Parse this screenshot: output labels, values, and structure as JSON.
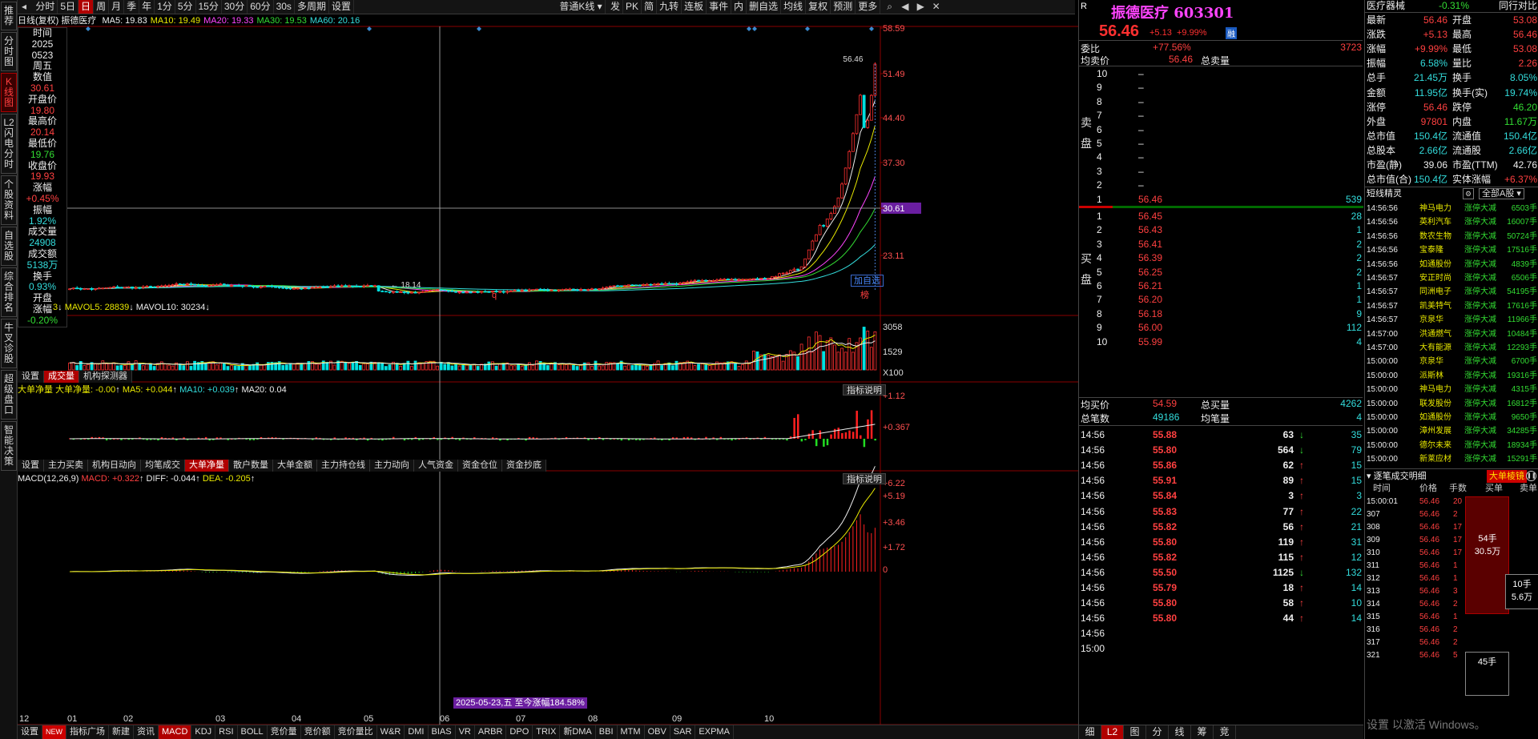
{
  "left_tabs": [
    "推荐",
    "分时图",
    "K线图",
    "L2闪电分时",
    "个股资料",
    "自选股",
    "综合排名",
    "牛叉诊股",
    "超级盘口",
    "智能决策"
  ],
  "toolbar": {
    "items": [
      "分时",
      "5日",
      "日",
      "周",
      "月",
      "季",
      "年",
      "1分",
      "5分",
      "15分",
      "30分",
      "60分",
      "30s",
      "多周期",
      "设置"
    ],
    "kline_type": "普通K线",
    "right_items": [
      "发",
      "PK",
      "简",
      "九转",
      "连板",
      "事件",
      "内",
      "删自选",
      "均线",
      "复权",
      "预测",
      "更多"
    ]
  },
  "kline": {
    "title": "日线(复权)",
    "stock": "振德医疗",
    "ma": [
      {
        "label": "MA5: 19.83",
        "color": "#eeeeee"
      },
      {
        "label": "MA10: 19.49",
        "color": "#e8e800"
      },
      {
        "label": "MA20: 19.33",
        "color": "#ff44ff"
      },
      {
        "label": "MA30: 19.53",
        "color": "#33dd33"
      },
      {
        "label": "MA60: 20.16",
        "color": "#33dddd"
      }
    ],
    "yticks": [
      "58.59",
      "51.49",
      "44.40",
      "37.30",
      "30.61",
      "23.11"
    ],
    "cursor_price": "30.61",
    "high_label": "56.46",
    "low_label": "18.14",
    "add_watch": "加自选",
    "q_marker": "q",
    "bang_marker": "榜"
  },
  "data_panel": [
    {
      "k": "时间",
      "c": "w"
    },
    {
      "k": "2025",
      "c": "w"
    },
    {
      "k": "0523",
      "c": "w"
    },
    {
      "k": "周五",
      "c": "w"
    },
    {
      "k": "数值",
      "c": "w"
    },
    {
      "k": "30.61",
      "c": "r"
    },
    {
      "k": "开盘价",
      "c": "w"
    },
    {
      "k": "19.80",
      "c": "r"
    },
    {
      "k": "最高价",
      "c": "w"
    },
    {
      "k": "20.14",
      "c": "r"
    },
    {
      "k": "最低价",
      "c": "w"
    },
    {
      "k": "19.76",
      "c": "g"
    },
    {
      "k": "收盘价",
      "c": "w"
    },
    {
      "k": "19.93",
      "c": "r"
    },
    {
      "k": "涨幅",
      "c": "w"
    },
    {
      "k": "+0.45%",
      "c": "r"
    },
    {
      "k": "振幅",
      "c": "w"
    },
    {
      "k": "1.92%",
      "c": "c"
    },
    {
      "k": "成交量",
      "c": "w"
    },
    {
      "k": "24908",
      "c": "c"
    },
    {
      "k": "成交额",
      "c": "w"
    },
    {
      "k": "5138万",
      "c": "c"
    },
    {
      "k": "换手",
      "c": "w"
    },
    {
      "k": "0.93%",
      "c": "c"
    },
    {
      "k": "开盘",
      "c": "w"
    },
    {
      "k": "涨幅",
      "c": "w"
    },
    {
      "k": "-0.20%",
      "c": "g"
    }
  ],
  "volume": {
    "info_prefix": "3",
    "mavol5": "MAVOL5: 28839",
    "mavol10": "MAVOL10: 30234",
    "yticks": [
      "3058",
      "1529"
    ],
    "unit": "X100"
  },
  "vol_tabs": [
    "设置",
    "成交量",
    "机构探测器"
  ],
  "bigorder": {
    "title": "大单净量",
    "line": "大单净量: -0.00",
    "ma5": "MA5: +0.044",
    "ma10": "MA10: +0.039",
    "ma20": "MA20: 0.04",
    "indicator_btn": "指标说明",
    "yticks": [
      "+1.12",
      "+0.367"
    ]
  },
  "flow_tabs": [
    "设置",
    "主力买卖",
    "机构日动向",
    "均笔成交",
    "大单净量",
    "散户数量",
    "大单金额",
    "主力持仓线",
    "主力动向",
    "人气资金",
    "资金仓位",
    "资金抄底"
  ],
  "macd": {
    "title": "MACD(12,26,9)",
    "macd": "MACD: +0.322",
    "diff": "DIFF: -0.044",
    "dea": "DEA: -0.205",
    "indicator_btn": "指标说明",
    "yticks": [
      "+6.22",
      "+5.19",
      "+3.46",
      "+1.72",
      "0"
    ],
    "date_marker": "2025-05-23,五 至今涨幅184.58%"
  },
  "xaxis": [
    "12",
    "01",
    "02",
    "03",
    "04",
    "05",
    "06",
    "07",
    "08",
    "09",
    "10"
  ],
  "bottom_bar": [
    "设置",
    "NEW",
    "指标广场",
    "新建",
    "资讯",
    "MACD",
    "KDJ",
    "RSI",
    "BOLL",
    "竞价量",
    "竞价额",
    "竞价量比",
    "W&R",
    "DMI",
    "BIAS",
    "VR",
    "ARBR",
    "DPO",
    "TRIX",
    "新DMA",
    "BBI",
    "MTM",
    "OBV",
    "SAR",
    "EXPMA"
  ],
  "quote": {
    "market": "R",
    "name": "振德医疗",
    "code": "603301",
    "price": "56.46",
    "change": "+5.13",
    "pct": "+9.99%",
    "badge": "融",
    "weibi_label": "委比",
    "weibi": "+77.56%",
    "weicha": "3723",
    "avg_sell_label": "均卖价",
    "avg_sell": "56.46",
    "total_sell_label": "总卖量",
    "total_sell": "",
    "sell_label": "卖盘",
    "buy_label": "买盘",
    "sells": [
      {
        "n": "10",
        "p": "–",
        "v": ""
      },
      {
        "n": "9",
        "p": "–",
        "v": ""
      },
      {
        "n": "8",
        "p": "–",
        "v": ""
      },
      {
        "n": "7",
        "p": "–",
        "v": ""
      },
      {
        "n": "6",
        "p": "–",
        "v": ""
      },
      {
        "n": "5",
        "p": "–",
        "v": ""
      },
      {
        "n": "4",
        "p": "–",
        "v": ""
      },
      {
        "n": "3",
        "p": "–",
        "v": ""
      },
      {
        "n": "2",
        "p": "–",
        "v": ""
      },
      {
        "n": "1",
        "p": "56.46",
        "v": "539"
      }
    ],
    "buys": [
      {
        "n": "1",
        "p": "56.45",
        "v": "28"
      },
      {
        "n": "2",
        "p": "56.43",
        "v": "1"
      },
      {
        "n": "3",
        "p": "56.41",
        "v": "2"
      },
      {
        "n": "4",
        "p": "56.39",
        "v": "2"
      },
      {
        "n": "5",
        "p": "56.25",
        "v": "2"
      },
      {
        "n": "6",
        "p": "56.21",
        "v": "1"
      },
      {
        "n": "7",
        "p": "56.20",
        "v": "1"
      },
      {
        "n": "8",
        "p": "56.18",
        "v": "9"
      },
      {
        "n": "9",
        "p": "56.00",
        "v": "112"
      },
      {
        "n": "10",
        "p": "55.99",
        "v": "4"
      }
    ],
    "avg_buy_label": "均买价",
    "avg_buy": "54.59",
    "total_buy_label": "总买量",
    "total_buy": "4262",
    "total_trades_label": "总笔数",
    "total_trades": "49186",
    "avg_trade_label": "均笔量",
    "avg_trade": "4",
    "ticks": [
      {
        "t": "14:56",
        "p": "55.88",
        "v": "63",
        "d": "down",
        "n": "35"
      },
      {
        "t": "14:56",
        "p": "55.80",
        "v": "564",
        "d": "down",
        "n": "79"
      },
      {
        "t": "14:56",
        "p": "55.86",
        "v": "62",
        "d": "up",
        "n": "15"
      },
      {
        "t": "14:56",
        "p": "55.91",
        "v": "89",
        "d": "up",
        "n": "15"
      },
      {
        "t": "14:56",
        "p": "55.84",
        "v": "3",
        "d": "up",
        "n": "3"
      },
      {
        "t": "14:56",
        "p": "55.83",
        "v": "77",
        "d": "up",
        "n": "22"
      },
      {
        "t": "14:56",
        "p": "55.82",
        "v": "56",
        "d": "up",
        "n": "21"
      },
      {
        "t": "14:56",
        "p": "55.80",
        "v": "119",
        "d": "up",
        "n": "31"
      },
      {
        "t": "14:56",
        "p": "55.82",
        "v": "115",
        "d": "up",
        "n": "12"
      },
      {
        "t": "14:56",
        "p": "55.50",
        "v": "1125",
        "d": "down",
        "n": "132"
      },
      {
        "t": "14:56",
        "p": "55.79",
        "v": "18",
        "d": "up",
        "n": "14"
      },
      {
        "t": "14:56",
        "p": "55.80",
        "v": "58",
        "d": "up",
        "n": "10"
      },
      {
        "t": "14:56",
        "p": "55.80",
        "v": "44",
        "d": "up",
        "n": "14"
      },
      {
        "t": "14:56",
        "p": "",
        "v": "",
        "d": "",
        "n": ""
      },
      {
        "t": "15:00",
        "p": "",
        "v": "",
        "d": "",
        "n": ""
      }
    ],
    "bottom_tabs": [
      "细",
      "L2",
      "图",
      "分",
      "线",
      "筹",
      "竞"
    ]
  },
  "stats": {
    "sector": "医疗器械",
    "sector_pct": "-0.31%",
    "sector_link": "同行对比",
    "rows": [
      [
        "最新",
        "56.46",
        "r",
        "开盘",
        "53.08",
        "r"
      ],
      [
        "涨跌",
        "+5.13",
        "r",
        "最高",
        "56.46",
        "r"
      ],
      [
        "涨幅",
        "+9.99%",
        "r",
        "最低",
        "53.08",
        "r"
      ],
      [
        "振幅",
        "6.58%",
        "c",
        "量比",
        "2.26",
        "r"
      ],
      [
        "总手",
        "21.45万",
        "c",
        "换手",
        "8.05%",
        "c"
      ],
      [
        "金额",
        "11.95亿",
        "c",
        "换手(实)",
        "19.74%",
        "c"
      ],
      [
        "涨停",
        "56.46",
        "r",
        "跌停",
        "46.20",
        "g"
      ],
      [
        "外盘",
        "97801",
        "r",
        "内盘",
        "11.67万",
        "g"
      ],
      [
        "总市值",
        "150.4亿",
        "c",
        "流通值",
        "150.4亿",
        "c"
      ],
      [
        "总股本",
        "2.66亿",
        "c",
        "流通股",
        "2.66亿",
        "c"
      ],
      [
        "市盈(静)",
        "39.06",
        "w",
        "市盈(TTM)",
        "42.76",
        "w"
      ],
      [
        "总市值(合)",
        "150.4亿",
        "c",
        "实体涨幅",
        "+6.37%",
        "r"
      ]
    ],
    "elf_title": "短线精灵",
    "elf_filter": "全部A股",
    "elf": [
      [
        "14:56:56",
        "神马电力",
        "涨停大减",
        "6503手"
      ],
      [
        "14:56:56",
        "英利汽车",
        "涨停大减",
        "16007手"
      ],
      [
        "14:56:56",
        "数农生物",
        "涨停大减",
        "50724手"
      ],
      [
        "14:56:56",
        "宝泰隆",
        "涨停大减",
        "17516手"
      ],
      [
        "14:56:56",
        "如通股份",
        "涨停大减",
        "4839手"
      ],
      [
        "14:56:57",
        "安正时尚",
        "涨停大减",
        "6506手"
      ],
      [
        "14:56:57",
        "同洲电子",
        "涨停大减",
        "54195手"
      ],
      [
        "14:56:57",
        "凯美特气",
        "涨停大减",
        "17616手"
      ],
      [
        "14:56:57",
        "京泉华",
        "涨停大减",
        "11966手"
      ],
      [
        "14:57:00",
        "洪通燃气",
        "涨停大减",
        "10484手"
      ],
      [
        "14:57:00",
        "大有能源",
        "涨停大减",
        "12293手"
      ],
      [
        "15:00:00",
        "京泉华",
        "涨停大减",
        "6700手"
      ],
      [
        "15:00:00",
        "派斯林",
        "涨停大减",
        "19316手"
      ],
      [
        "15:00:00",
        "神马电力",
        "涨停大减",
        "4315手"
      ],
      [
        "15:00:00",
        "联发股份",
        "涨停大减",
        "16812手"
      ],
      [
        "15:00:00",
        "如通股份",
        "涨停大减",
        "9650手"
      ],
      [
        "15:00:00",
        "漳州发展",
        "涨停大减",
        "34285手"
      ],
      [
        "15:00:00",
        "德尔未来",
        "涨停大减",
        "18934手"
      ],
      [
        "15:00:00",
        "新莱应材",
        "涨停大减",
        "15291手"
      ]
    ],
    "ticker_title": "逐笔成交明细",
    "ticker_btn": "大单棱镜",
    "ticker_head": [
      "时间",
      "价格",
      "手数",
      "买单",
      "卖单"
    ],
    "ticker": [
      [
        "15:00:01",
        "56.46",
        "20"
      ],
      [
        "307",
        "56.46",
        "2"
      ],
      [
        "308",
        "56.46",
        "17"
      ],
      [
        "309",
        "56.46",
        "17"
      ],
      [
        "310",
        "56.46",
        "17"
      ],
      [
        "311",
        "56.46",
        "1"
      ],
      [
        "312",
        "56.46",
        "1"
      ],
      [
        "313",
        "56.46",
        "3"
      ],
      [
        "314",
        "56.46",
        "2"
      ],
      [
        "315",
        "56.46",
        "1"
      ],
      [
        "316",
        "56.46",
        "2"
      ],
      [
        "317",
        "56.46",
        "2"
      ],
      [
        "321",
        "56.46",
        "5"
      ]
    ],
    "big_buy": "54手",
    "big_buy_amt": "30.5万",
    "big_sell": "10手",
    "big_sell_amt": "5.6万",
    "big_buy2": "45手",
    "watermark": "设置 以激活 Windows。"
  }
}
